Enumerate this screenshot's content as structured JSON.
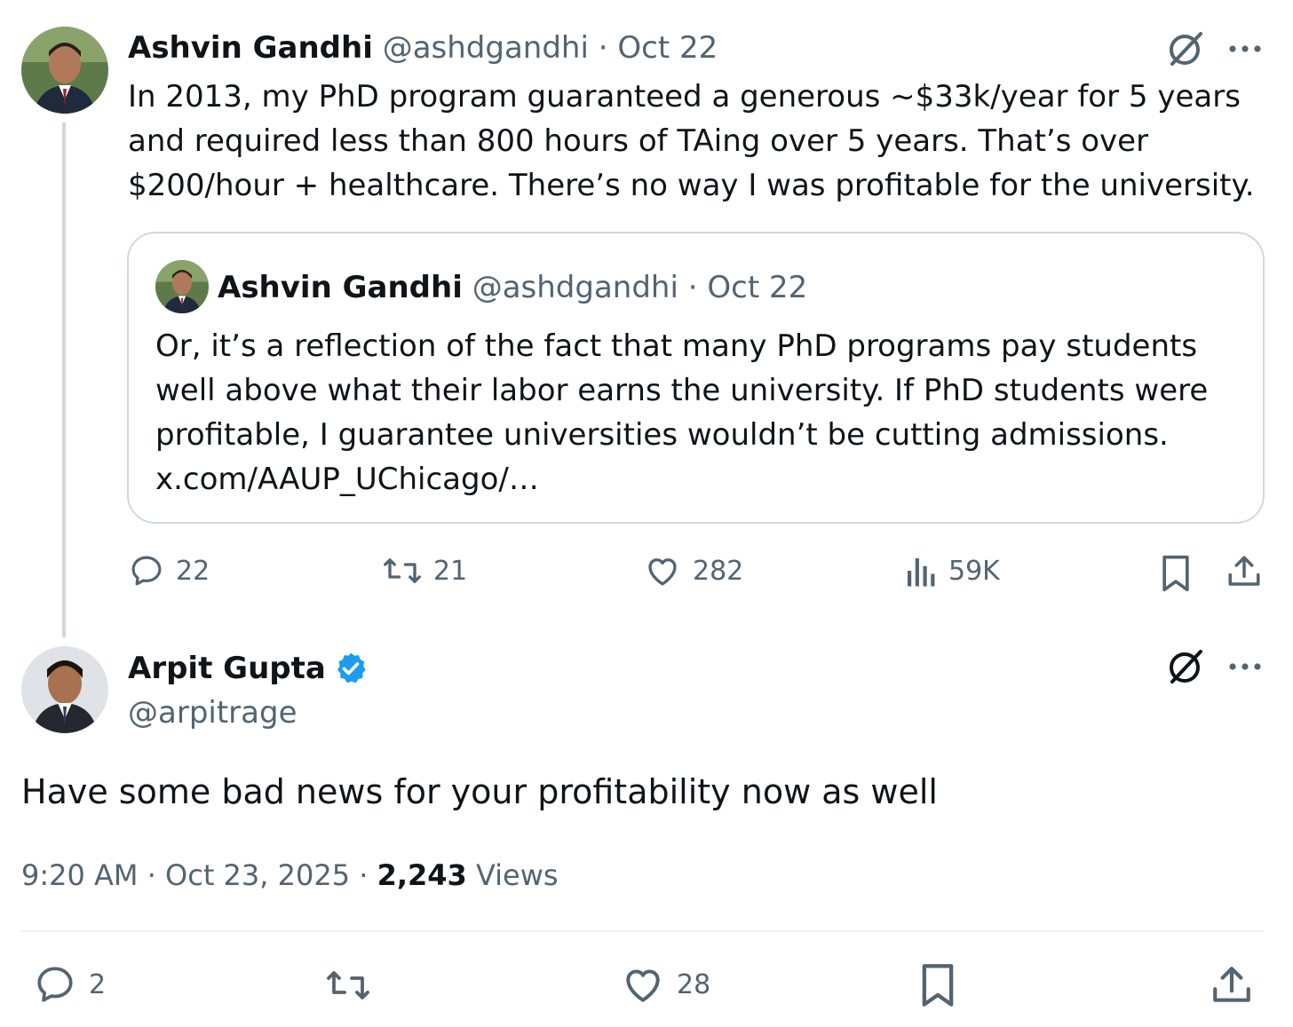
{
  "parent_tweet": {
    "author_name": "Ashvin Gandhi",
    "handle": "@ashdgandhi",
    "sep": "·",
    "date": "Oct 22",
    "text": "In 2013, my PhD program guaranteed a generous ~$33k/year for 5 years and required less than 800 hours of TAing over 5 years. That’s  over $200/hour + healthcare. There’s no way I was profitable for the university.",
    "quoted": {
      "author_name": "Ashvin Gandhi",
      "handle": "@ashdgandhi",
      "sep": "·",
      "date": "Oct 22",
      "text": "Or, it’s a reflection of the fact that many PhD programs pay students well above what their labor earns the university.    If PhD students were profitable, I guarantee universities wouldn’t be cutting admissions.",
      "link": "x.com/AAUP_UChicago/…"
    },
    "actions": {
      "replies": "22",
      "reposts": "21",
      "likes": "282",
      "views": "59K"
    }
  },
  "main_tweet": {
    "author_name": "Arpit Gupta",
    "handle": "@arpitrage",
    "text": "Have some bad news for your profitability now as well",
    "time": "9:20 AM",
    "sep1": "·",
    "date": "Oct 23, 2025",
    "sep2": "·",
    "views_count": "2,243",
    "views_label": "Views",
    "actions": {
      "replies": "2",
      "likes": "28"
    }
  },
  "icons": {
    "grok": "grok-icon",
    "more": "more-icon",
    "reply": "reply-icon",
    "repost": "repost-icon",
    "like": "like-icon",
    "views": "views-icon",
    "bookmark": "bookmark-icon",
    "share": "share-icon",
    "verified": "verified-badge-icon"
  },
  "colors": {
    "text": "#0f1419",
    "muted": "#536471",
    "border": "#cfd9de",
    "verified": "#1d9bf0"
  }
}
